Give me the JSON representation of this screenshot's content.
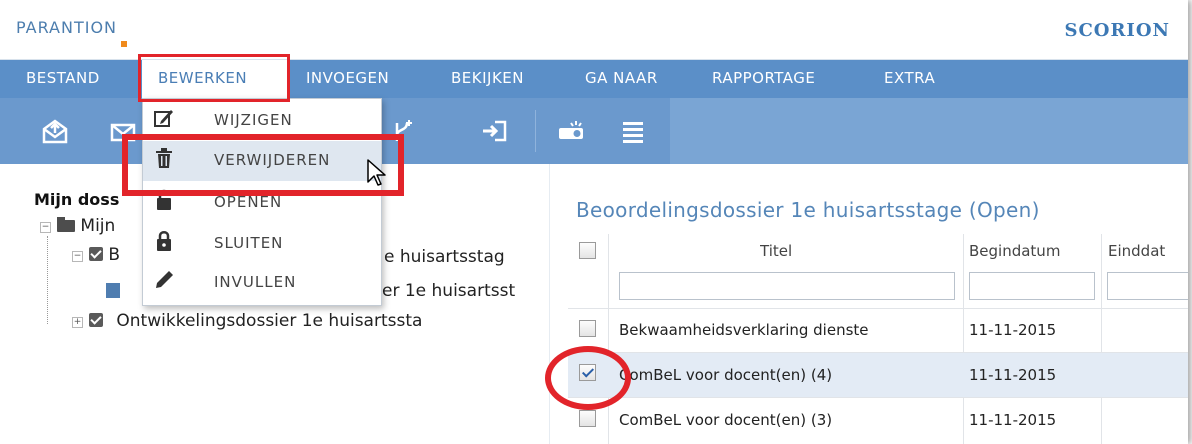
{
  "brand": {
    "left_logo": "PARANTION",
    "right_logo": "SCORION",
    "accent": "#f08a1c"
  },
  "menu": {
    "items": [
      {
        "label": "BESTAND"
      },
      {
        "label": "BEWERKEN",
        "active": true
      },
      {
        "label": "INVOEGEN"
      },
      {
        "label": "BEKIJKEN"
      },
      {
        "label": "GA NAAR"
      },
      {
        "label": "RAPPORTAGE"
      },
      {
        "label": "EXTRA"
      }
    ]
  },
  "toolbar": {
    "icons": [
      "envelope-up-icon",
      "envelope-icon",
      "branch-icon",
      "sign-in-icon",
      "projector-icon",
      "list-icon"
    ]
  },
  "dropdown": {
    "items": [
      {
        "label": "WIJZIGEN",
        "icon": "edit-icon"
      },
      {
        "label": "VERWIJDEREN",
        "icon": "trash-icon",
        "hover": true
      },
      {
        "label": "OPENEN",
        "icon": "lock-open-icon"
      },
      {
        "label": "SLUITEN",
        "icon": "lock-icon"
      },
      {
        "label": "INVULLEN",
        "icon": "pencil-icon"
      }
    ]
  },
  "tree": {
    "title": "Mijn doss",
    "nodes": [
      {
        "label": "Mijn"
      },
      {
        "label": "B",
        "tail": "e huisartsstag"
      },
      {
        "label": "",
        "tail": "er 1e huisartsst"
      },
      {
        "label": "Ontwikkelingsdossier 1e huisartssta"
      }
    ]
  },
  "panel": {
    "title": "Beoordelingsdossier 1e huisartsstage (Open)",
    "columns": [
      "Titel",
      "Begindatum",
      "Einddat"
    ],
    "rows": [
      {
        "titel": "Bekwaamheidsverklaring dienste",
        "begindatum": "11-11-2015",
        "checked": false
      },
      {
        "titel": "ComBeL voor docent(en) (4)",
        "begindatum": "11-11-2015",
        "checked": true
      },
      {
        "titel": "ComBeL voor docent(en) (3)",
        "begindatum": "11-11-2015",
        "checked": false
      }
    ]
  },
  "colors": {
    "menubar": "#5b8fc8",
    "toolbar": "#6b99cd",
    "highlight": "#e2242a",
    "title": "#5586b8"
  }
}
